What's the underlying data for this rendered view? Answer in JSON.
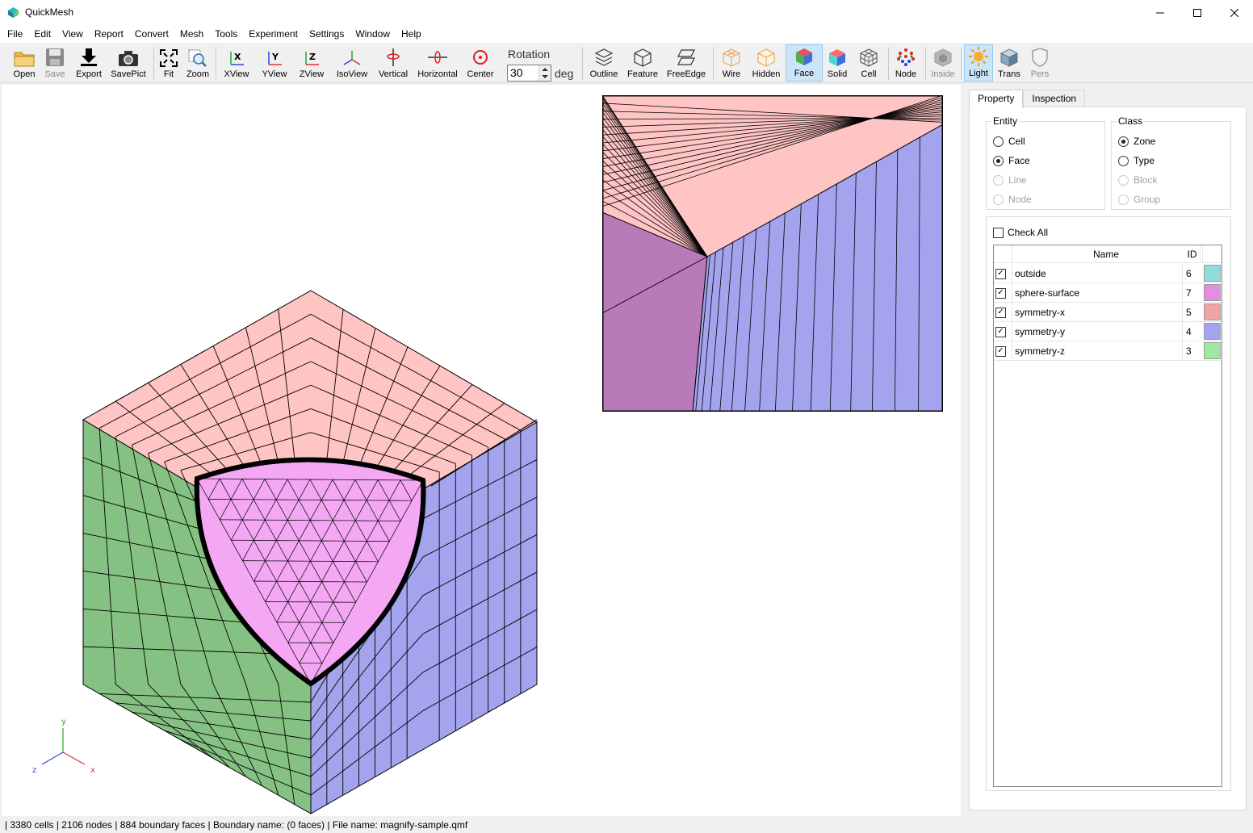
{
  "window": {
    "title": "QuickMesh"
  },
  "menu": [
    "File",
    "Edit",
    "View",
    "Report",
    "Convert",
    "Mesh",
    "Tools",
    "Experiment",
    "Settings",
    "Window",
    "Help"
  ],
  "toolbar": {
    "open": "Open",
    "save": "Save",
    "export": "Export",
    "savepict": "SavePict",
    "fit": "Fit",
    "zoom": "Zoom",
    "xview": "XView",
    "yview": "YView",
    "zview": "ZView",
    "isoview": "IsoView",
    "vertical": "Vertical",
    "horizontal": "Horizontal",
    "center": "Center",
    "rotation_label": "Rotation",
    "rotation_value": "30",
    "rotation_unit": "deg",
    "outline": "Outline",
    "feature": "Feature",
    "freeedge": "FreeEdge",
    "wire": "Wire",
    "hidden": "Hidden",
    "face": "Face",
    "solid": "Solid",
    "cell": "Cell",
    "node": "Node",
    "inside": "Inside",
    "light": "Light",
    "trans": "Trans",
    "pers": "Pers"
  },
  "axes": {
    "y": "y",
    "z": "z",
    "x": "x"
  },
  "panel": {
    "tabs": [
      "Property",
      "Inspection"
    ],
    "entity": {
      "legend": "Entity",
      "options": [
        "Cell",
        "Face",
        "Line",
        "Node"
      ],
      "selected": "Face"
    },
    "class": {
      "legend": "Class",
      "options": [
        "Zone",
        "Type",
        "Block",
        "Group"
      ],
      "selected": "Zone"
    },
    "check_all": "Check All",
    "columns": {
      "name": "Name",
      "id": "ID"
    },
    "rows": [
      {
        "name": "outside",
        "id": "6",
        "color": "#8fdcdc"
      },
      {
        "name": "sphere-surface",
        "id": "7",
        "color": "#e38de3"
      },
      {
        "name": "symmetry-x",
        "id": "5",
        "color": "#f2a3a3"
      },
      {
        "name": "symmetry-y",
        "id": "4",
        "color": "#a3a3ee"
      },
      {
        "name": "symmetry-z",
        "id": "3",
        "color": "#9fe89f"
      }
    ]
  },
  "status": "| 3380 cells | 2106 nodes | 884 boundary faces |   Boundary name:  (0 faces) | File name: magnify-sample.qmf"
}
